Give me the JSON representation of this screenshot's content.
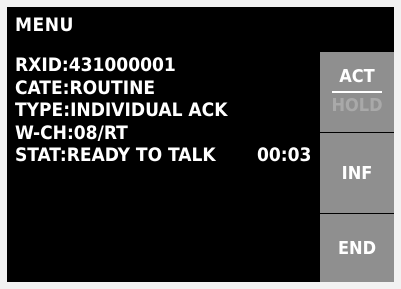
{
  "menu": {
    "title": "MENU"
  },
  "info": {
    "rxid": "RXID:431000001",
    "cate": "CATE:ROUTINE",
    "type": "TYPE:INDIVIDUAL ACK",
    "wch": "W-CH:08/RT",
    "stat": "STAT:READY TO TALK",
    "timer": "00:03"
  },
  "softkeys": {
    "act": "ACT",
    "hold": "HOLD",
    "inf": "INF",
    "end": "END"
  },
  "colors": {
    "screen_bg": "#000000",
    "text": "#ffffff",
    "softkey_bg": "#8f8f8f",
    "disabled_text": "#a9a9a9"
  }
}
